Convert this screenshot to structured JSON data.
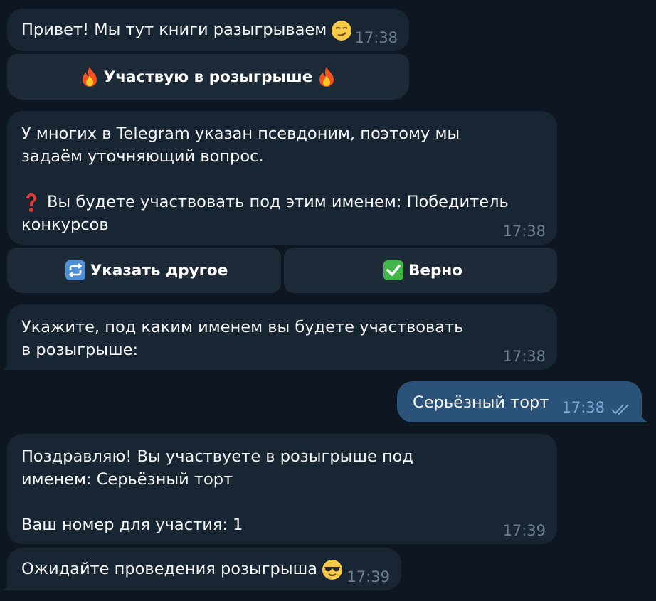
{
  "messages": [
    {
      "text": "Привет! Мы тут книги разыгрываем",
      "emoji": "smirking-face",
      "time": "17:38"
    },
    {
      "text": "У многих в Telegram указан псевдоним, поэтому мы задаём уточняющий вопрос.",
      "question_text": "Вы будете участвовать под этим именем: Победитель конкурсов",
      "emoji": "red-question-mark",
      "time": "17:38"
    },
    {
      "text": "Укажите, под каким именем вы будете участвовать в розыгрыше:",
      "time": "17:38"
    },
    {
      "text": "Серьёзный торт",
      "time": "17:38",
      "status": "read-double-check",
      "outgoing": true
    },
    {
      "text": "Поздравляю! Вы участвуете в розыгрыше под именем: Серьёзный торт",
      "number_text": "Ваш номер для участия: 1",
      "time": "17:39"
    },
    {
      "text": "Ожидайте проведения розыгрыша",
      "emoji": "sunglasses-face",
      "time": "17:39"
    }
  ],
  "buttons": {
    "participate": {
      "label": "Участвую в розыгрыше",
      "icon": "fire"
    },
    "specify_other": {
      "label": "Указать другое",
      "icon": "repeat-arrows"
    },
    "correct": {
      "label": "Верно",
      "icon": "green-check-mark"
    }
  },
  "colors": {
    "background": "#0e1621",
    "incoming_bubble": "#182533",
    "outgoing_bubble": "#2b5278",
    "button": "#1d2a38",
    "time_incoming": "#6d7f8f",
    "time_outgoing": "#7da8d3"
  }
}
